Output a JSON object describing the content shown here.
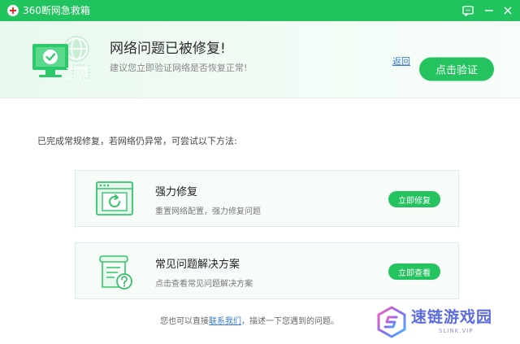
{
  "window": {
    "title": "360断网急救箱"
  },
  "header": {
    "title": "网络问题已被修复!",
    "subtitle": "建议您立即验证网络是否恢复正常!",
    "back_label": "返回",
    "verify_label": "点击验证"
  },
  "intro_text": "已完成常规修复，若网络仍异常，可尝试以下方法:",
  "cards": [
    {
      "title": "强力修复",
      "description": "重置网络配置，强力修复问题",
      "button": "立即修复",
      "icon": "browser-refresh-icon"
    },
    {
      "title": "常见问题解决方案",
      "description": "点击查看常见问题解决方案",
      "button": "立即查看",
      "icon": "document-help-icon"
    }
  ],
  "footer": {
    "prefix": "您也可以直接",
    "link": "联系我们",
    "suffix": "，描述一下您遇到的问题。"
  },
  "watermark": {
    "text": "速链游戏园",
    "sub": "SLINK.VIP"
  },
  "colors": {
    "accent": "#24c360",
    "titlebar": "#21c35e",
    "link": "#3b7bd4"
  }
}
